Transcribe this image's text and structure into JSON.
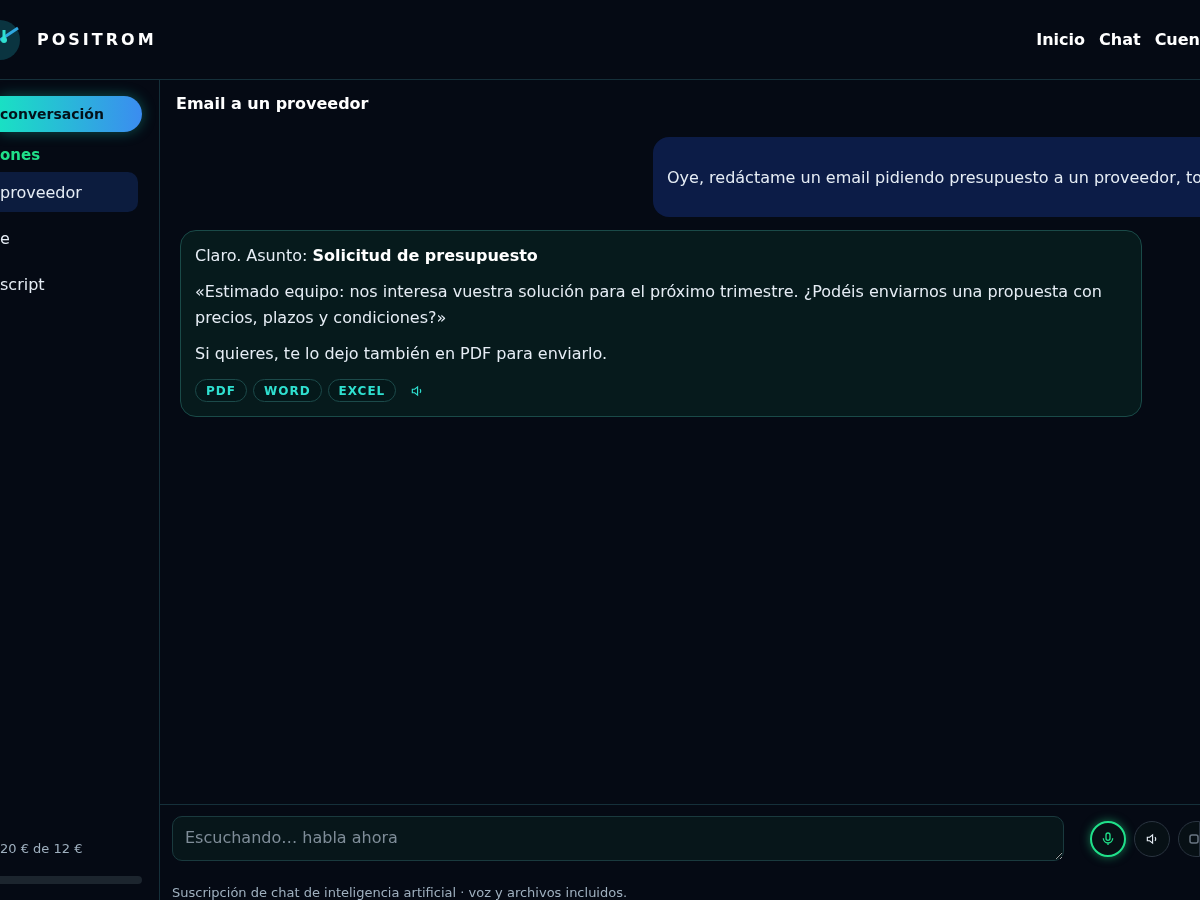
{
  "header": {
    "brand": "POSITROM",
    "nav": [
      {
        "label": "Inicio"
      },
      {
        "label": "Chat"
      },
      {
        "label": "Cuen"
      }
    ]
  },
  "sidebar": {
    "new_chat": "conversación",
    "section_title": "ones",
    "items": [
      {
        "label": "proveedor",
        "selected": true
      },
      {
        "label": "e",
        "selected": false
      },
      {
        "label": "script",
        "selected": false
      }
    ],
    "usage": "20 € de 12 €"
  },
  "chat": {
    "title": "Email a un proveedor",
    "messages": [
      {
        "kind": "user",
        "text": "Oye, redáctame un email pidiendo presupuesto a un proveedor, to"
      },
      {
        "kind": "assistant",
        "paragraphs": [
          "Claro. Asunto: **Solicitud de presupuesto**",
          "«Estimado equipo: nos interesa vuestra solución para el próximo trimestre. ¿Podéis enviarnos una propuesta con precios, plazos y condiciones?»",
          "Si quieres, te lo dejo también en PDF para enviarlo."
        ],
        "exports": [
          "PDF",
          "WORD",
          "EXCEL"
        ]
      }
    ]
  },
  "composer": {
    "placeholder": "Escuchando… habla ahora",
    "listening": true
  },
  "footer": "Suscripción de chat de inteligencia artificial · voz y archivos incluidos."
}
